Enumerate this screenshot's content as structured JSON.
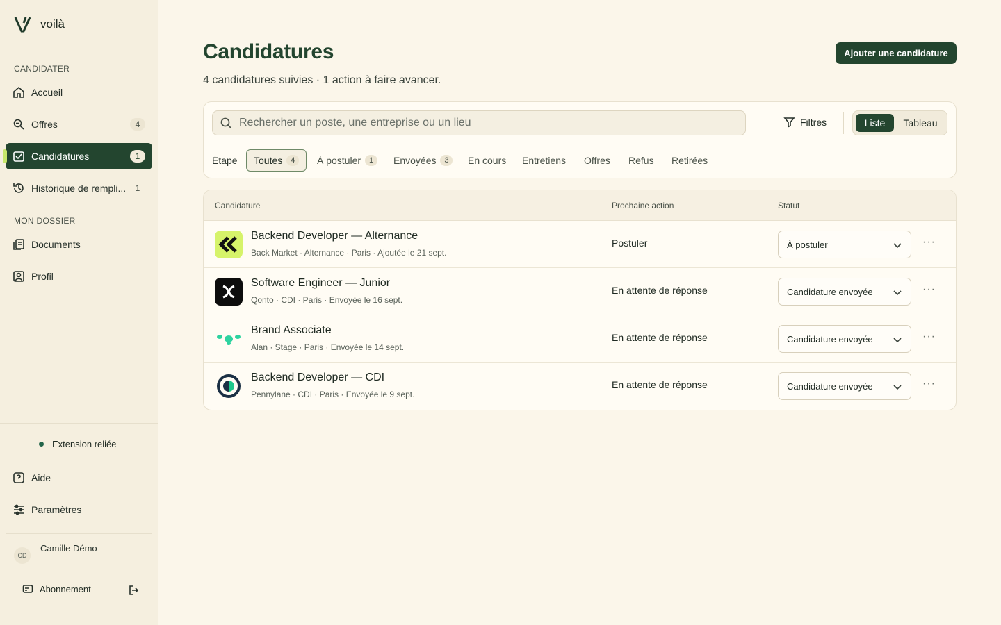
{
  "brand": {
    "name": "voilà"
  },
  "sidebar": {
    "section_apply": "CANDIDATER",
    "section_file": "MON DOSSIER",
    "items": [
      {
        "label": "Accueil",
        "icon": "home-icon",
        "count": ""
      },
      {
        "label": "Offres",
        "icon": "search-offers-icon",
        "count": "4"
      },
      {
        "label": "Candidatures",
        "icon": "applications-icon",
        "count": "1"
      },
      {
        "label": "Historique de rempli...",
        "icon": "history-icon",
        "count": "1"
      },
      {
        "label": "Documents",
        "icon": "documents-icon",
        "count": ""
      },
      {
        "label": "Profil",
        "icon": "profile-icon",
        "count": ""
      }
    ],
    "extension_status": "Extension reliée",
    "help": "Aide",
    "settings": "Paramètres",
    "user": {
      "initials": "CD",
      "name": "Camille Démo"
    },
    "subscription": "Abonnement"
  },
  "header": {
    "title": "Candidatures",
    "subtitle": "4 candidatures suivies · 1 action à faire avancer.",
    "add_button": "Ajouter une candidature"
  },
  "filters": {
    "search_placeholder": "Rechercher un poste, une entreprise ou un lieu",
    "filters_label": "Filtres",
    "view_list": "Liste",
    "view_board": "Tableau",
    "stage_label": "Étape",
    "stages": [
      {
        "label": "Toutes",
        "count": "4"
      },
      {
        "label": "À postuler",
        "count": "1"
      },
      {
        "label": "Envoyées",
        "count": "3"
      },
      {
        "label": "En cours",
        "count": ""
      },
      {
        "label": "Entretiens",
        "count": ""
      },
      {
        "label": "Offres",
        "count": ""
      },
      {
        "label": "Refus",
        "count": ""
      },
      {
        "label": "Retirées",
        "count": ""
      }
    ]
  },
  "table": {
    "columns": [
      "Candidature",
      "Prochaine action",
      "Statut"
    ],
    "rows": [
      {
        "title": "Backend Developer — Alternance",
        "meta": "Back Market · Alternance · Paris · Ajoutée le 21 sept.",
        "next_action": "Postuler",
        "status": "À postuler",
        "logo": "back-market-logo"
      },
      {
        "title": "Software Engineer — Junior",
        "meta": "Qonto · CDI · Paris · Envoyée le 16 sept.",
        "next_action": "En attente de réponse",
        "status": "Candidature envoyée",
        "logo": "qonto-logo"
      },
      {
        "title": "Brand Associate",
        "meta": "Alan · Stage · Paris · Envoyée le 14 sept.",
        "next_action": "En attente de réponse",
        "status": "Candidature envoyée",
        "logo": "alan-logo"
      },
      {
        "title": "Backend Developer — CDI",
        "meta": "Pennylane · CDI · Paris · Envoyée le 9 sept.",
        "next_action": "En attente de réponse",
        "status": "Candidature envoyée",
        "logo": "pennylane-logo"
      }
    ]
  },
  "colors": {
    "accent": "#23452f",
    "background": "#fbf6ea",
    "highlight": "#c7e86b"
  }
}
